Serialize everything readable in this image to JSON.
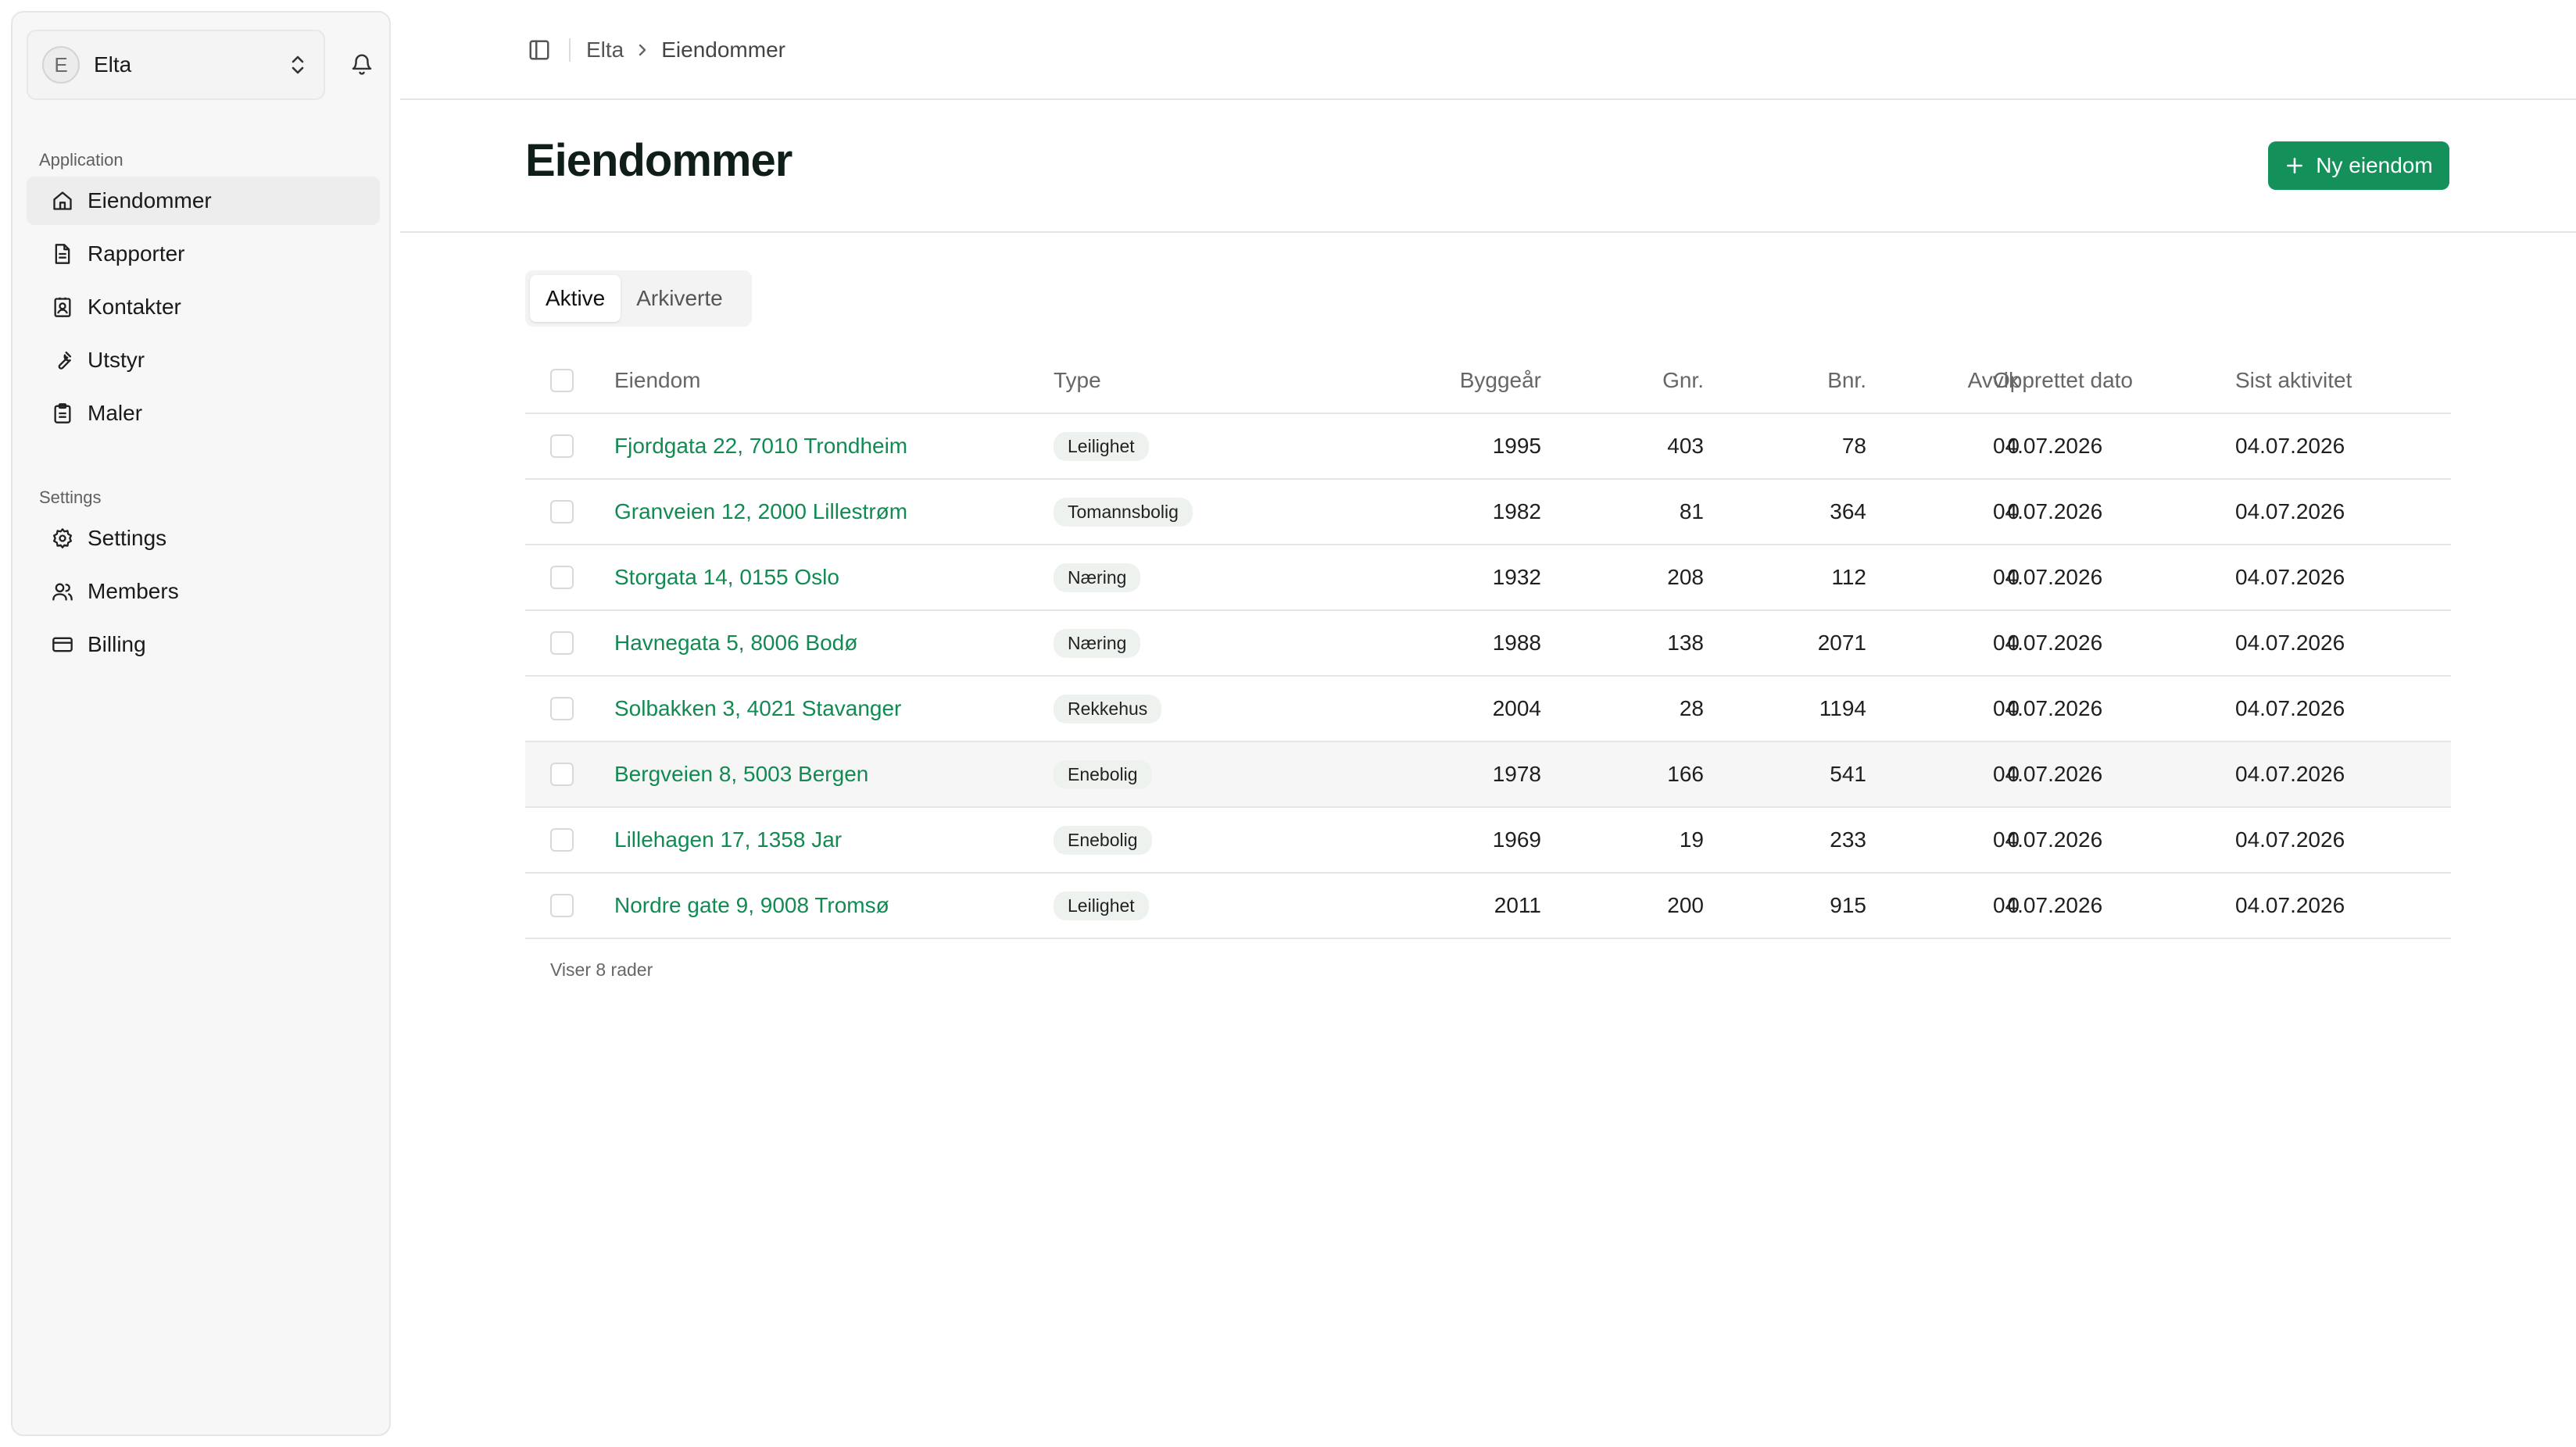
{
  "org": {
    "avatar_letter": "E",
    "name": "Elta"
  },
  "sidebar": {
    "sections": [
      {
        "label": "Application",
        "items": [
          {
            "label": "Eiendommer",
            "icon": "home-icon",
            "active": true
          },
          {
            "label": "Rapporter",
            "icon": "file-text-icon",
            "active": false
          },
          {
            "label": "Kontakter",
            "icon": "contact-icon",
            "active": false
          },
          {
            "label": "Utstyr",
            "icon": "wrench-icon",
            "active": false
          },
          {
            "label": "Maler",
            "icon": "clipboard-icon",
            "active": false
          }
        ]
      },
      {
        "label": "Settings",
        "items": [
          {
            "label": "Settings",
            "icon": "gear-icon",
            "active": false
          },
          {
            "label": "Members",
            "icon": "users-icon",
            "active": false
          },
          {
            "label": "Billing",
            "icon": "credit-card-icon",
            "active": false
          }
        ]
      }
    ]
  },
  "breadcrumb": {
    "parent": "Elta",
    "current": "Eiendommer"
  },
  "page": {
    "title": "Eiendommer",
    "new_button_label": "Ny eiendom"
  },
  "tabs": [
    {
      "label": "Aktive",
      "active": true
    },
    {
      "label": "Arkiverte",
      "active": false
    }
  ],
  "table": {
    "columns": [
      "Eiendom",
      "Type",
      "Byggeår",
      "Gnr.",
      "Bnr.",
      "Avvik",
      "Opprettet dato",
      "Sist aktivitet"
    ],
    "rows": [
      {
        "eiendom": "Fjordgata 22, 7010 Trondheim",
        "type": "Leilighet",
        "byggear": "1995",
        "gnr": "403",
        "bnr": "78",
        "avvik": "0",
        "opprettet": "04.07.2026",
        "sist": "04.07.2026"
      },
      {
        "eiendom": "Granveien 12, 2000 Lillestrøm",
        "type": "Tomannsbolig",
        "byggear": "1982",
        "gnr": "81",
        "bnr": "364",
        "avvik": "0",
        "opprettet": "04.07.2026",
        "sist": "04.07.2026"
      },
      {
        "eiendom": "Storgata 14, 0155 Oslo",
        "type": "Næring",
        "byggear": "1932",
        "gnr": "208",
        "bnr": "112",
        "avvik": "0",
        "opprettet": "04.07.2026",
        "sist": "04.07.2026"
      },
      {
        "eiendom": "Havnegata 5, 8006 Bodø",
        "type": "Næring",
        "byggear": "1988",
        "gnr": "138",
        "bnr": "2071",
        "avvik": "0",
        "opprettet": "04.07.2026",
        "sist": "04.07.2026"
      },
      {
        "eiendom": "Solbakken 3, 4021 Stavanger",
        "type": "Rekkehus",
        "byggear": "2004",
        "gnr": "28",
        "bnr": "1194",
        "avvik": "0",
        "opprettet": "04.07.2026",
        "sist": "04.07.2026"
      },
      {
        "eiendom": "Bergveien 8, 5003 Bergen",
        "type": "Enebolig",
        "byggear": "1978",
        "gnr": "166",
        "bnr": "541",
        "avvik": "0",
        "opprettet": "04.07.2026",
        "sist": "04.07.2026"
      },
      {
        "eiendom": "Lillehagen 17, 1358 Jar",
        "type": "Enebolig",
        "byggear": "1969",
        "gnr": "19",
        "bnr": "233",
        "avvik": "0",
        "opprettet": "04.07.2026",
        "sist": "04.07.2026"
      },
      {
        "eiendom": "Nordre gate 9, 9008 Tromsø",
        "type": "Leilighet",
        "byggear": "2011",
        "gnr": "200",
        "bnr": "915",
        "avvik": "0",
        "opprettet": "04.07.2026",
        "sist": "04.07.2026"
      }
    ],
    "footer": "Viser 8 rader"
  },
  "colors": {
    "accent": "#14905a",
    "link": "#128a52"
  }
}
